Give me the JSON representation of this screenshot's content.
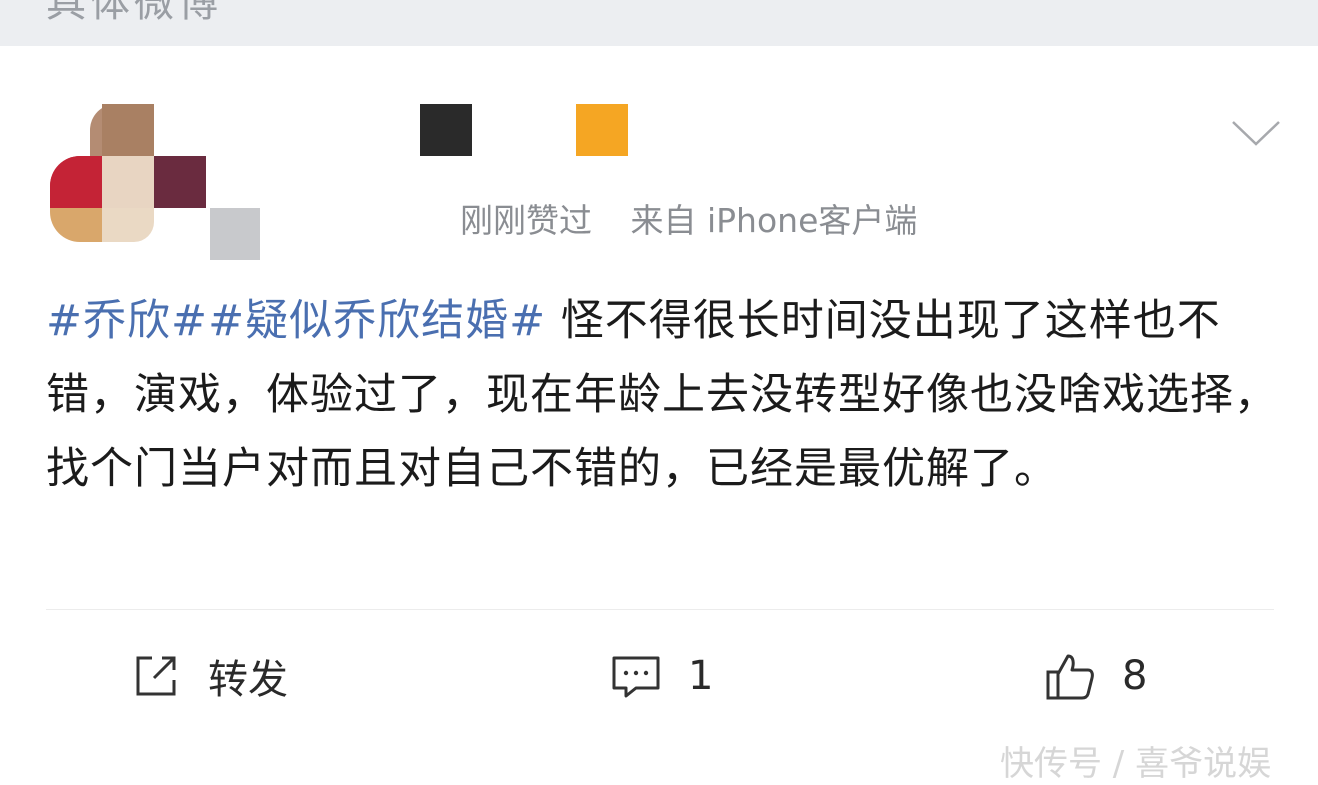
{
  "header": {
    "cut_text": "具体微博"
  },
  "post": {
    "avatar_icon": "avatar-mosaic",
    "dropdown_icon": "chevron-down-icon",
    "meta": {
      "liked": "刚刚赞过",
      "source": "来自 iPhone客户端"
    },
    "hashtags": [
      "#乔欣#",
      "#疑似乔欣结婚#"
    ],
    "text": " 怪不得很长时间没出现了这样也不错，演戏，体验过了，现在年龄上去没转型好像也没啥戏选择，找个门当户对而且对自己不错的，已经是最优解了。",
    "name_block_colors": [
      "#2a2a2a",
      "#f5a623"
    ]
  },
  "actions": {
    "repost": {
      "icon": "repost-icon",
      "label": "转发"
    },
    "comment": {
      "icon": "comment-icon",
      "count": "1"
    },
    "like": {
      "icon": "thumbs-up-icon",
      "count": "8"
    }
  },
  "watermark": "快传号 / 喜爷说娱"
}
